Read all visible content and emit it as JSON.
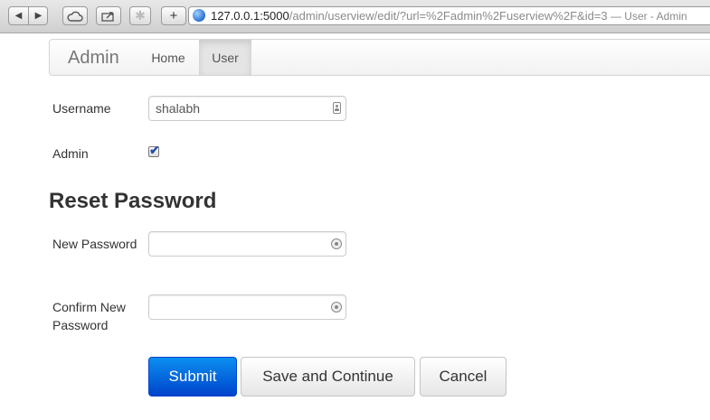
{
  "browser": {
    "url_host": "127.0.0.1:5000",
    "url_path": "/admin/userview/edit/?url=%2Fadmin%2Fuserview%2F&id=3",
    "page_title": " — User - Admin",
    "back_glyph": "◀",
    "forward_glyph": "▶",
    "add_glyph": "+"
  },
  "navbar": {
    "brand": "Admin",
    "items": [
      {
        "label": "Home"
      },
      {
        "label": "User"
      }
    ]
  },
  "form": {
    "username_label": "Username",
    "username_value": "shalabh",
    "admin_label": "Admin",
    "admin_checked": true,
    "reset_title": "Reset Password",
    "new_password_label": "New Password",
    "confirm_label_line1": "Confirm New",
    "confirm_label_line2": "Password"
  },
  "actions": {
    "submit": "Submit",
    "save_continue": "Save and Continue",
    "cancel": "Cancel"
  }
}
